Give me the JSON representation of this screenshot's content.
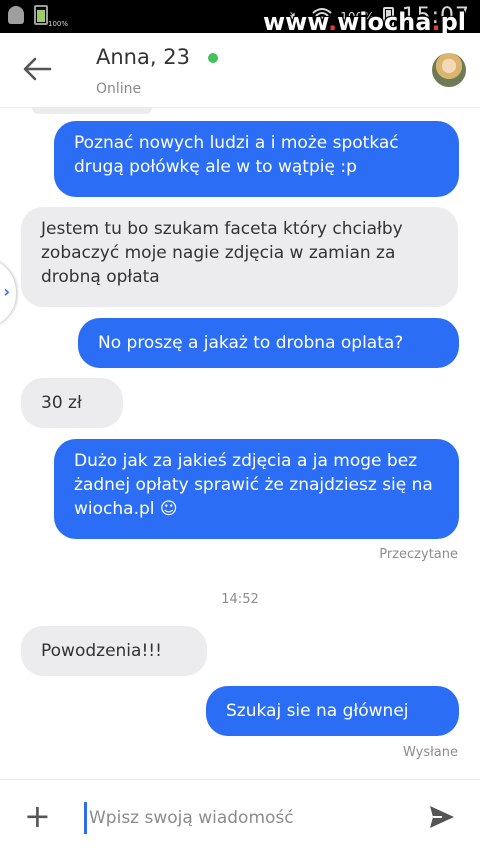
{
  "status_bar": {
    "battery_small_label": "100%",
    "battery_percent": "100%",
    "time": "15:07",
    "watermark_name": "www",
    "watermark_site": "wiocha",
    "watermark_tld": "pl"
  },
  "header": {
    "title": "Anna, 23",
    "status": "Online"
  },
  "messages": [
    {
      "from": "me",
      "text": "Poznać nowych ludzi a i może spotkać drugą połówkę ale w to wątpię :p"
    },
    {
      "from": "them",
      "text": "Jestem tu bo szukam faceta który chciałby zobaczyć moje nagie zdjęcia w zamian za drobną opłata"
    },
    {
      "from": "me",
      "text": "No proszę a jakaż to drobna oplata?"
    },
    {
      "from": "them",
      "text": "30 zł"
    },
    {
      "from": "me",
      "text": "Dużo jak za jakieś zdjęcia a ja moge bez żadnej opłaty sprawić że znajdziesz się na wiocha.pl ☺"
    },
    {
      "from": "them",
      "text": "Powodzenia!!!"
    },
    {
      "from": "me",
      "text": "Szukaj sie na głównej"
    }
  ],
  "read_status": "Przeczytane",
  "time_divider": "14:52",
  "sent_status": "Wysłane",
  "composer": {
    "placeholder": "Wpisz swoją wiadomość"
  },
  "colors": {
    "outgoing_bubble": "#2b6ef5",
    "incoming_bubble": "#ececef",
    "online": "#43c25a"
  }
}
